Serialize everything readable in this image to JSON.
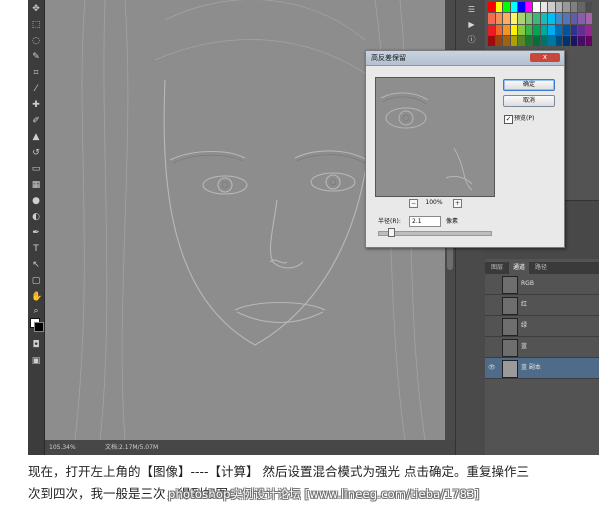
{
  "status": {
    "zoom": "105.34%",
    "doc": "文档:2.17M/5.07M"
  },
  "dialog": {
    "title": "高反差保留",
    "close_label": "x",
    "ok_label": "确定",
    "cancel_label": "取消",
    "preview_label": "预览(P)",
    "preview_checked": true,
    "zoom_level": "100%",
    "radius_label": "半径(R):",
    "radius_value": "2.1",
    "radius_unit": "像素",
    "radius_slider_fraction": 0.1
  },
  "layers_panel": {
    "tabs": [
      {
        "label": "图层"
      },
      {
        "label": "通道"
      },
      {
        "label": "路径"
      }
    ],
    "active_tab": "通道",
    "channels": [
      {
        "name": "RGB"
      },
      {
        "name": "红"
      },
      {
        "name": "绿"
      },
      {
        "name": "蓝"
      },
      {
        "name": "蓝 副本"
      }
    ],
    "selected_channel": "蓝 副本"
  },
  "icons": {
    "close": "close-icon",
    "eye": "eye-icon",
    "zoom_out": "zoom-out-icon",
    "zoom_in": "zoom-in-icon"
  },
  "caption": {
    "line1": "现在，打开左上角的【图像】----【计算】 然后设置混合模式为强光 点击确定。重复操作三",
    "line2": "次到四次，我一般是三次，得到如图："
  },
  "watermark": "photoshop实例设计论坛 [www.lineeg.com/tieba/1783]",
  "colors": {
    "workspace": "#535353",
    "canvas_gray": "#8d8d8d",
    "dialog_bg": "#e9e9e9",
    "selected_layer": "#4f6b8a"
  }
}
